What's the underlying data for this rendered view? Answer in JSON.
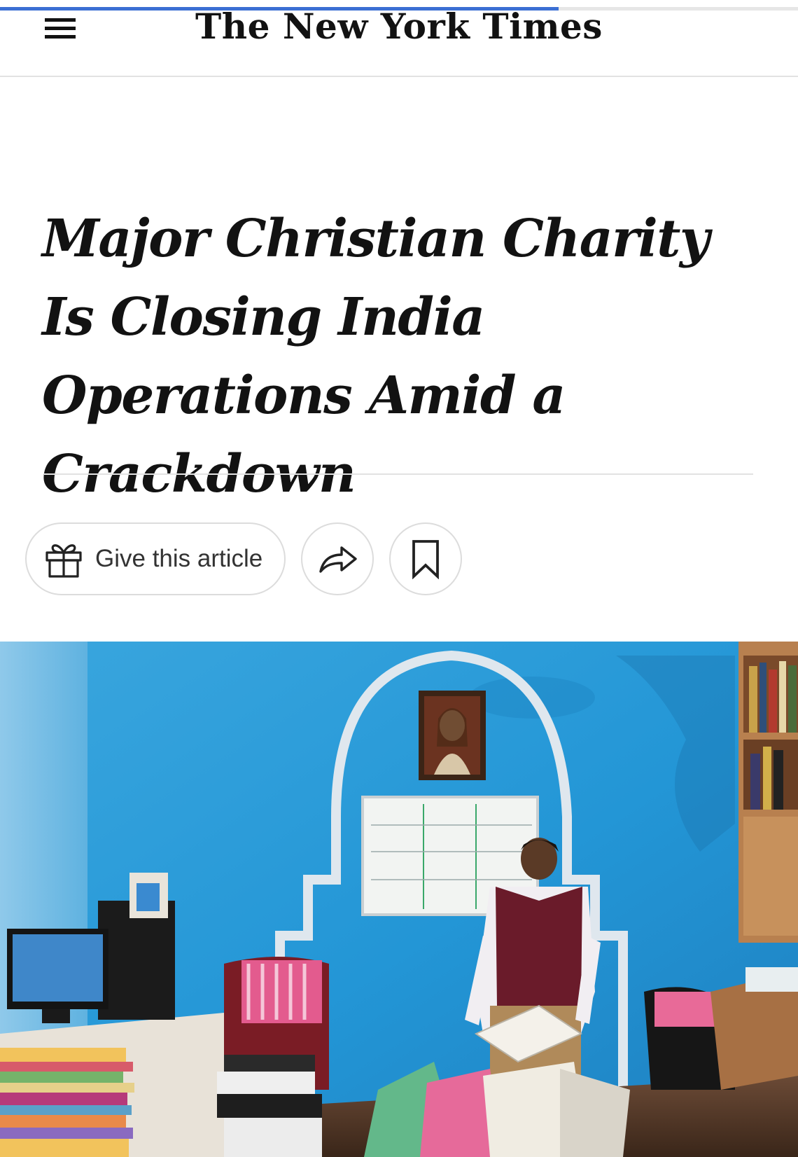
{
  "masthead": {
    "logo_text": "The New York Times",
    "reading_progress_fraction": 0.7
  },
  "article": {
    "headline": "Major Christian Charity Is Closing India Operations Amid a Crackdown"
  },
  "actions": {
    "gift_label": "Give this article"
  },
  "icons": {
    "menu": "hamburger-menu-icon",
    "gift": "gift-icon",
    "share": "share-arrow-icon",
    "save": "bookmark-icon"
  },
  "colors": {
    "progress": "#3b6fd3",
    "text": "#121212",
    "border": "#dcdcdc",
    "wall_blue": "#2fa3dd"
  }
}
